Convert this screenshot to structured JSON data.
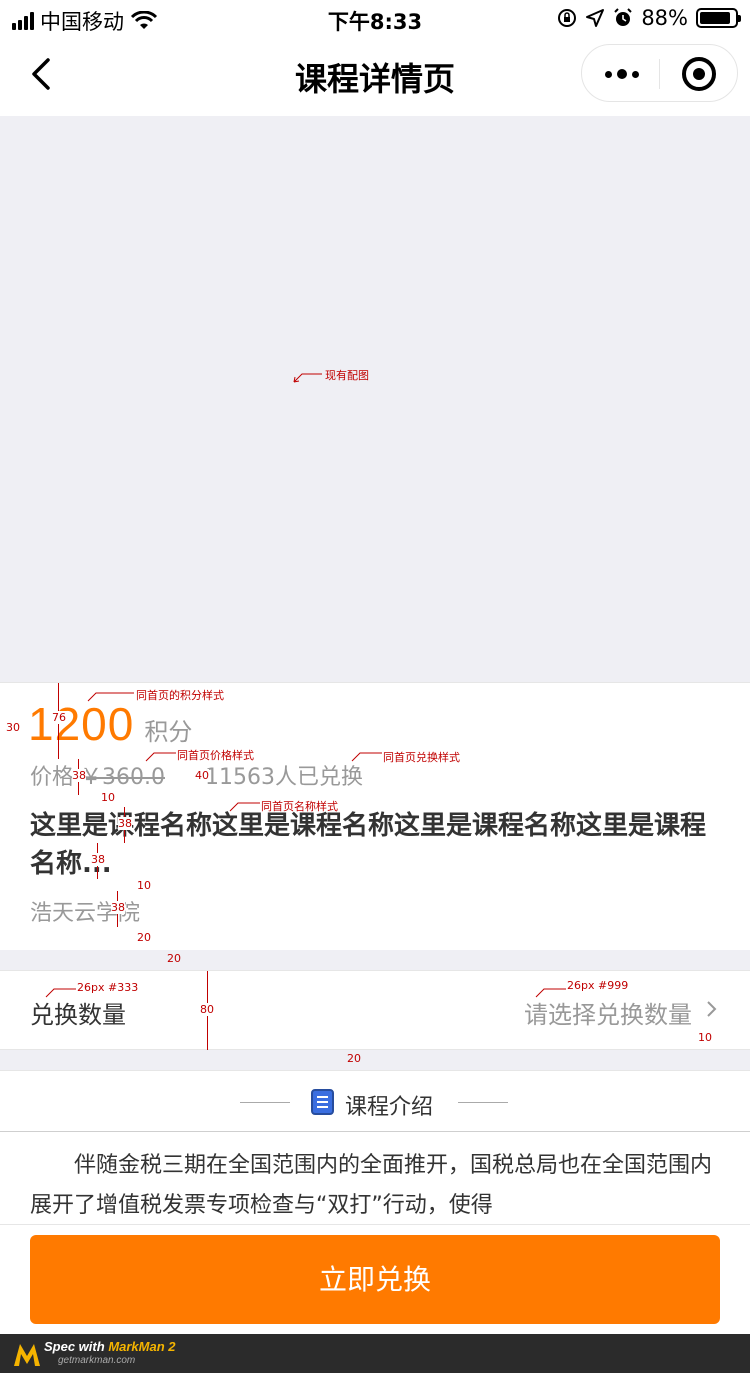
{
  "status_bar": {
    "carrier": "中国移动",
    "time": "下午8:33",
    "battery_percent": "88%",
    "battery_level": 0.88,
    "icons": [
      "signal-icon",
      "wifi-icon",
      "orientation-lock-icon",
      "location-icon",
      "alarm-icon",
      "battery-icon"
    ]
  },
  "nav": {
    "title": "课程详情页",
    "icons": [
      "back-icon",
      "more-icon",
      "close-icon"
    ]
  },
  "banner": {
    "annotation": "现有配图"
  },
  "course": {
    "points": "1200",
    "points_unit": "积分",
    "price_label": "价格",
    "price_value": "￥360.0",
    "exchanged_count": "11563人已兑换",
    "name": "这里是课程名称这里是课程名称这里是课程名称这里是课程名称...",
    "provider": "浩天云学院"
  },
  "quantity": {
    "label": "兑换数量",
    "placeholder": "请选择兑换数量",
    "icon": "chevron-right-icon"
  },
  "intro": {
    "title": "课程介绍",
    "icon": "notebook-icon",
    "body": "伴随金税三期在全国范围内的全面推开，国税总局也在全国范围内展开了增值税发票专项检查与“双打”行动，使得"
  },
  "action": {
    "exchange_label": "立即兑换"
  },
  "annotations": {
    "points_style": "同首页的积分样式",
    "price_style": "同首页价格样式",
    "exchange_style": "同首页兑换样式",
    "name_style": "同首页名称样式",
    "label_spec": "26px #333",
    "value_spec": "26px #999",
    "m30": "30",
    "m76": "76",
    "m38a": "38",
    "m40": "40",
    "m10a": "10",
    "m38b": "38",
    "m38c": "38",
    "m10b": "10",
    "m38d": "38",
    "m20a": "20",
    "m20b": "20",
    "m80": "80",
    "m20c": "20",
    "m10c": "10"
  },
  "footer": {
    "brand_prefix": "Spec with",
    "brand_name": "MarkMan 2",
    "url": "getmarkman.com"
  },
  "colors": {
    "accent": "#ff7a00",
    "text_primary": "#333333",
    "text_secondary": "#999999",
    "background": "#efeff4",
    "annotation": "#c00000"
  }
}
